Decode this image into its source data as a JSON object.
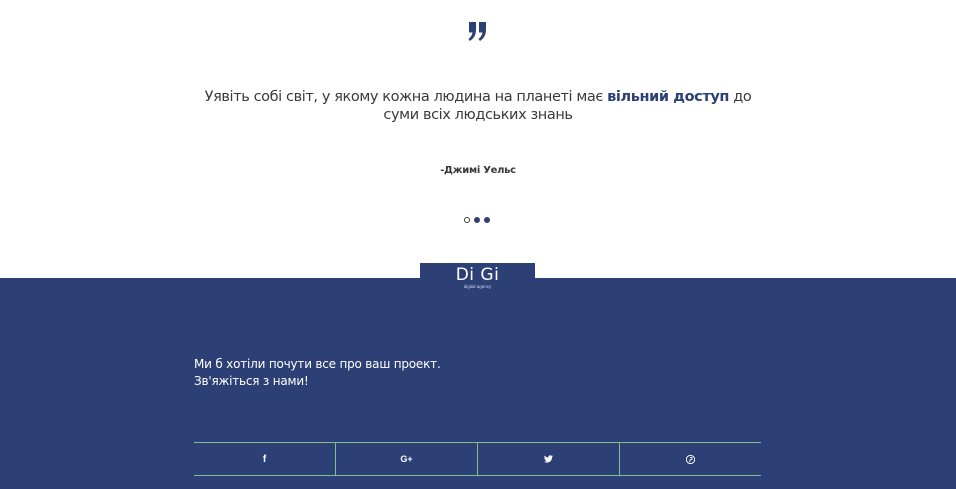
{
  "quote": {
    "icon": "quote-icon",
    "text_before": "Уявіть собі світ, у якому кожна людина на планеті має ",
    "text_highlight": "вільний доступ",
    "text_after": " до суми всіх людських знань",
    "author": "-Джимі Уельс"
  },
  "carousel": {
    "dots": [
      {
        "active": true
      },
      {
        "active": false
      },
      {
        "active": false
      }
    ]
  },
  "logo": {
    "main": "Di Gi",
    "sub": "digital agency"
  },
  "footer": {
    "contact_line1": "Ми б хотіли почути все про ваш проект.",
    "contact_line2": "Зв'яжіться з нами!",
    "social": [
      {
        "icon": "facebook-icon",
        "glyph": "f"
      },
      {
        "icon": "google-plus-icon",
        "glyph": "G+"
      },
      {
        "icon": "twitter-icon",
        "glyph": ""
      },
      {
        "icon": "pinterest-icon",
        "glyph": ""
      }
    ]
  },
  "colors": {
    "brand": "#2c4075",
    "divider": "#7fbf8f",
    "text": "#3a3a3a"
  }
}
